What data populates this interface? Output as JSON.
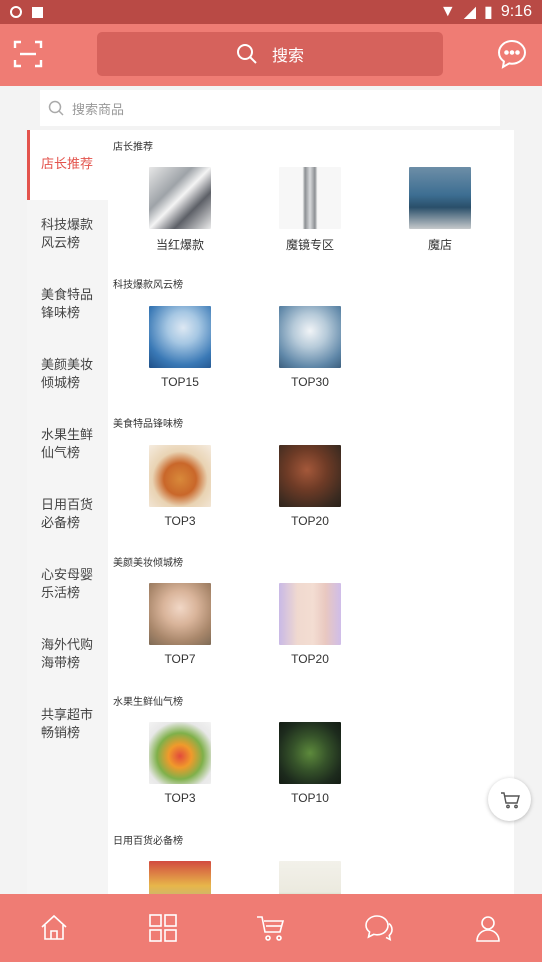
{
  "status_bar": {
    "time": "9:16"
  },
  "header": {
    "search_label": "搜索"
  },
  "sub_search": {
    "placeholder": "搜索商品"
  },
  "sidebar": {
    "items": [
      {
        "label": "店长推荐",
        "active": true
      },
      {
        "label": "科技爆款风云榜",
        "active": false
      },
      {
        "label": "美食特品锋味榜",
        "active": false
      },
      {
        "label": "美颜美妆倾城榜",
        "active": false
      },
      {
        "label": "水果生鲜仙气榜",
        "active": false
      },
      {
        "label": "日用百货必备榜",
        "active": false
      },
      {
        "label": "心安母婴乐活榜",
        "active": false
      },
      {
        "label": "海外代购海带榜",
        "active": false
      },
      {
        "label": "共享超市畅销榜",
        "active": false
      }
    ]
  },
  "sections": [
    {
      "title": "店长推荐",
      "tiles": [
        {
          "caption": "当红爆款",
          "icon": "collage-image"
        },
        {
          "caption": "魔镜专区",
          "icon": "mirror-kiosk-image"
        },
        {
          "caption": "魔店",
          "icon": "store-image"
        }
      ]
    },
    {
      "title": "科技爆款风云榜",
      "tiles": [
        {
          "caption": "TOP15",
          "icon": "tech-person-image"
        },
        {
          "caption": "TOP30",
          "icon": "robot-image"
        }
      ]
    },
    {
      "title": "美食特品锋味榜",
      "tiles": [
        {
          "caption": "TOP3",
          "icon": "food-plate-image"
        },
        {
          "caption": "TOP20",
          "icon": "steak-image"
        }
      ]
    },
    {
      "title": "美颜美妆倾城榜",
      "tiles": [
        {
          "caption": "TOP7",
          "icon": "model-portrait-image"
        },
        {
          "caption": "TOP20",
          "icon": "skincare-faces-image"
        }
      ]
    },
    {
      "title": "水果生鲜仙气榜",
      "tiles": [
        {
          "caption": "TOP3",
          "icon": "fruit-display-image"
        },
        {
          "caption": "TOP10",
          "icon": "vegetables-image"
        }
      ]
    },
    {
      "title": "日用百货必备榜",
      "tiles": [
        {
          "caption": "",
          "icon": "alarm-clock-image"
        },
        {
          "caption": "",
          "icon": "plant-image"
        }
      ]
    }
  ],
  "bottom_nav": [
    {
      "icon": "home-icon"
    },
    {
      "icon": "category-grid-icon"
    },
    {
      "icon": "cart-icon"
    },
    {
      "icon": "chat-icon"
    },
    {
      "icon": "user-icon"
    }
  ],
  "colors": {
    "header": "#ef7c74",
    "search": "#d6625c",
    "accent": "#e3534c",
    "status_bar": "#b94a45"
  }
}
